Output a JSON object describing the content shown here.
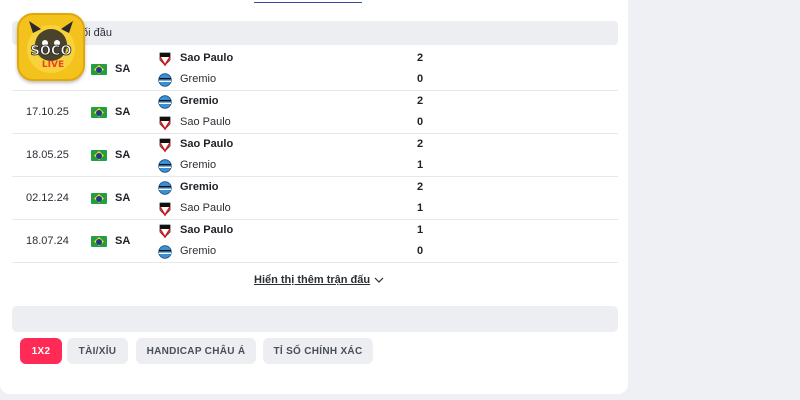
{
  "section": {
    "title": "ối đầu"
  },
  "logo": {
    "text_top": "SOCO",
    "text_bottom": "LIVE"
  },
  "matches": [
    {
      "date": "",
      "league": "SA",
      "home": {
        "name": "Sao Paulo",
        "score": "2",
        "winner": true,
        "crest": "sao-paulo-crest"
      },
      "away": {
        "name": "Gremio",
        "score": "0",
        "winner": false,
        "crest": "gremio-crest"
      }
    },
    {
      "date": "17.10.25",
      "league": "SA",
      "home": {
        "name": "Gremio",
        "score": "2",
        "winner": true,
        "crest": "gremio-crest"
      },
      "away": {
        "name": "Sao Paulo",
        "score": "0",
        "winner": false,
        "crest": "sao-paulo-crest"
      }
    },
    {
      "date": "18.05.25",
      "league": "SA",
      "home": {
        "name": "Sao Paulo",
        "score": "2",
        "winner": true,
        "crest": "sao-paulo-crest"
      },
      "away": {
        "name": "Gremio",
        "score": "1",
        "winner": false,
        "crest": "gremio-crest"
      }
    },
    {
      "date": "02.12.24",
      "league": "SA",
      "home": {
        "name": "Gremio",
        "score": "2",
        "winner": true,
        "crest": "gremio-crest"
      },
      "away": {
        "name": "Sao Paulo",
        "score": "1",
        "winner": false,
        "crest": "sao-paulo-crest"
      }
    },
    {
      "date": "18.07.24",
      "league": "SA",
      "home": {
        "name": "Sao Paulo",
        "score": "1",
        "winner": true,
        "crest": "sao-paulo-crest"
      },
      "away": {
        "name": "Gremio",
        "score": "0",
        "winner": false,
        "crest": "gremio-crest"
      }
    }
  ],
  "show_more": {
    "label": "Hiển thị thêm trận đấu"
  },
  "tabs": [
    {
      "label": "1X2",
      "active": true
    },
    {
      "label": "TÀI/XỈU",
      "active": false
    },
    {
      "label": "HANDICAP CHÂU Á",
      "active": false
    },
    {
      "label": "TỈ SỐ CHÍNH XÁC",
      "active": false
    }
  ],
  "colors": {
    "accent": "#ff2a55",
    "header_bg": "#eceef1",
    "logo_yellow": "#f4c21c"
  }
}
